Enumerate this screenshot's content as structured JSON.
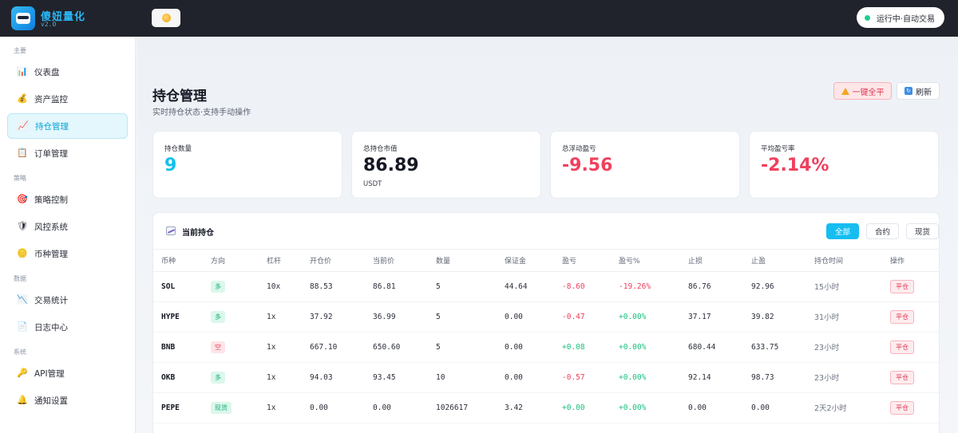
{
  "app": {
    "name": "傻妞量化",
    "version": "v2.0",
    "status": "运行中·自动交易",
    "theme_icon": "sun-icon"
  },
  "sidebar": {
    "groups": [
      {
        "label": "主要",
        "items": [
          {
            "label": "仪表盘",
            "icon": "bar-chart-icon"
          },
          {
            "label": "资产监控",
            "icon": "money-bag-icon"
          },
          {
            "label": "持仓管理",
            "icon": "trend-chart-icon",
            "active": true
          },
          {
            "label": "订单管理",
            "icon": "clipboard-icon"
          }
        ]
      },
      {
        "label": "策略",
        "items": [
          {
            "label": "策略控制",
            "icon": "target-icon"
          },
          {
            "label": "风控系统",
            "icon": "shield-icon"
          },
          {
            "label": "币种管理",
            "icon": "coin-icon"
          }
        ]
      },
      {
        "label": "数据",
        "items": [
          {
            "label": "交易统计",
            "icon": "down-chart-icon"
          },
          {
            "label": "日志中心",
            "icon": "document-icon"
          }
        ]
      },
      {
        "label": "系统",
        "items": [
          {
            "label": "API管理",
            "icon": "key-icon"
          },
          {
            "label": "通知设置",
            "icon": "bell-icon"
          }
        ]
      }
    ]
  },
  "page": {
    "title": "持仓管理",
    "subtitle": "实时持仓状态·支持手动操作",
    "close_all_label": "一键全平",
    "refresh_label": "刷新"
  },
  "stats": [
    {
      "label": "持仓数量",
      "value": "9",
      "unit": "",
      "color": "#12c1ee"
    },
    {
      "label": "总持仓市值",
      "value": "86.89",
      "unit": "USDT",
      "color": "#151823"
    },
    {
      "label": "总浮动盈亏",
      "value": "-9.56",
      "unit": "",
      "color": "#f0405d"
    },
    {
      "label": "平均盈亏率",
      "value": "-2.14%",
      "unit": "",
      "color": "#f0405d"
    }
  ],
  "positions_panel": {
    "title": "当前持仓",
    "filters": [
      "全部",
      "合约",
      "现货"
    ],
    "active_filter": "全部",
    "columns": [
      "币种",
      "方向",
      "杠杆",
      "开仓价",
      "当前价",
      "数量",
      "保证金",
      "盈亏",
      "盈亏%",
      "止损",
      "止盈",
      "持仓时间",
      "操作"
    ],
    "rows": [
      {
        "symbol": "SOL",
        "direction": "多",
        "dir_type": "long",
        "leverage": "10x",
        "entry": "88.53",
        "current": "86.81",
        "qty": "5",
        "margin": "44.64",
        "pnl": "-8.60",
        "pnl_pct": "-19.26%",
        "sl": "86.76",
        "tp": "92.96",
        "duration": "15小时",
        "action": "平仓"
      },
      {
        "symbol": "HYPE",
        "direction": "多",
        "dir_type": "long",
        "leverage": "1x",
        "entry": "37.92",
        "current": "36.99",
        "qty": "5",
        "margin": "0.00",
        "pnl": "-0.47",
        "pnl_pct": "+0.00%",
        "sl": "37.17",
        "tp": "39.82",
        "duration": "31小时",
        "action": "平仓"
      },
      {
        "symbol": "BNB",
        "direction": "空",
        "dir_type": "short",
        "leverage": "1x",
        "entry": "667.10",
        "current": "650.60",
        "qty": "5",
        "margin": "0.00",
        "pnl": "+0.08",
        "pnl_pct": "+0.00%",
        "sl": "680.44",
        "tp": "633.75",
        "duration": "23小时",
        "action": "平仓"
      },
      {
        "symbol": "OKB",
        "direction": "多",
        "dir_type": "long",
        "leverage": "1x",
        "entry": "94.03",
        "current": "93.45",
        "qty": "10",
        "margin": "0.00",
        "pnl": "-0.57",
        "pnl_pct": "+0.00%",
        "sl": "92.14",
        "tp": "98.73",
        "duration": "23小时",
        "action": "平仓"
      },
      {
        "symbol": "PEPE",
        "direction": "现货",
        "dir_type": "spot",
        "leverage": "1x",
        "entry": "0.00",
        "current": "0.00",
        "qty": "1026617",
        "margin": "3.42",
        "pnl": "+0.00",
        "pnl_pct": "+0.00%",
        "sl": "0.00",
        "tp": "0.00",
        "duration": "2天2小时",
        "action": "平仓"
      }
    ]
  }
}
